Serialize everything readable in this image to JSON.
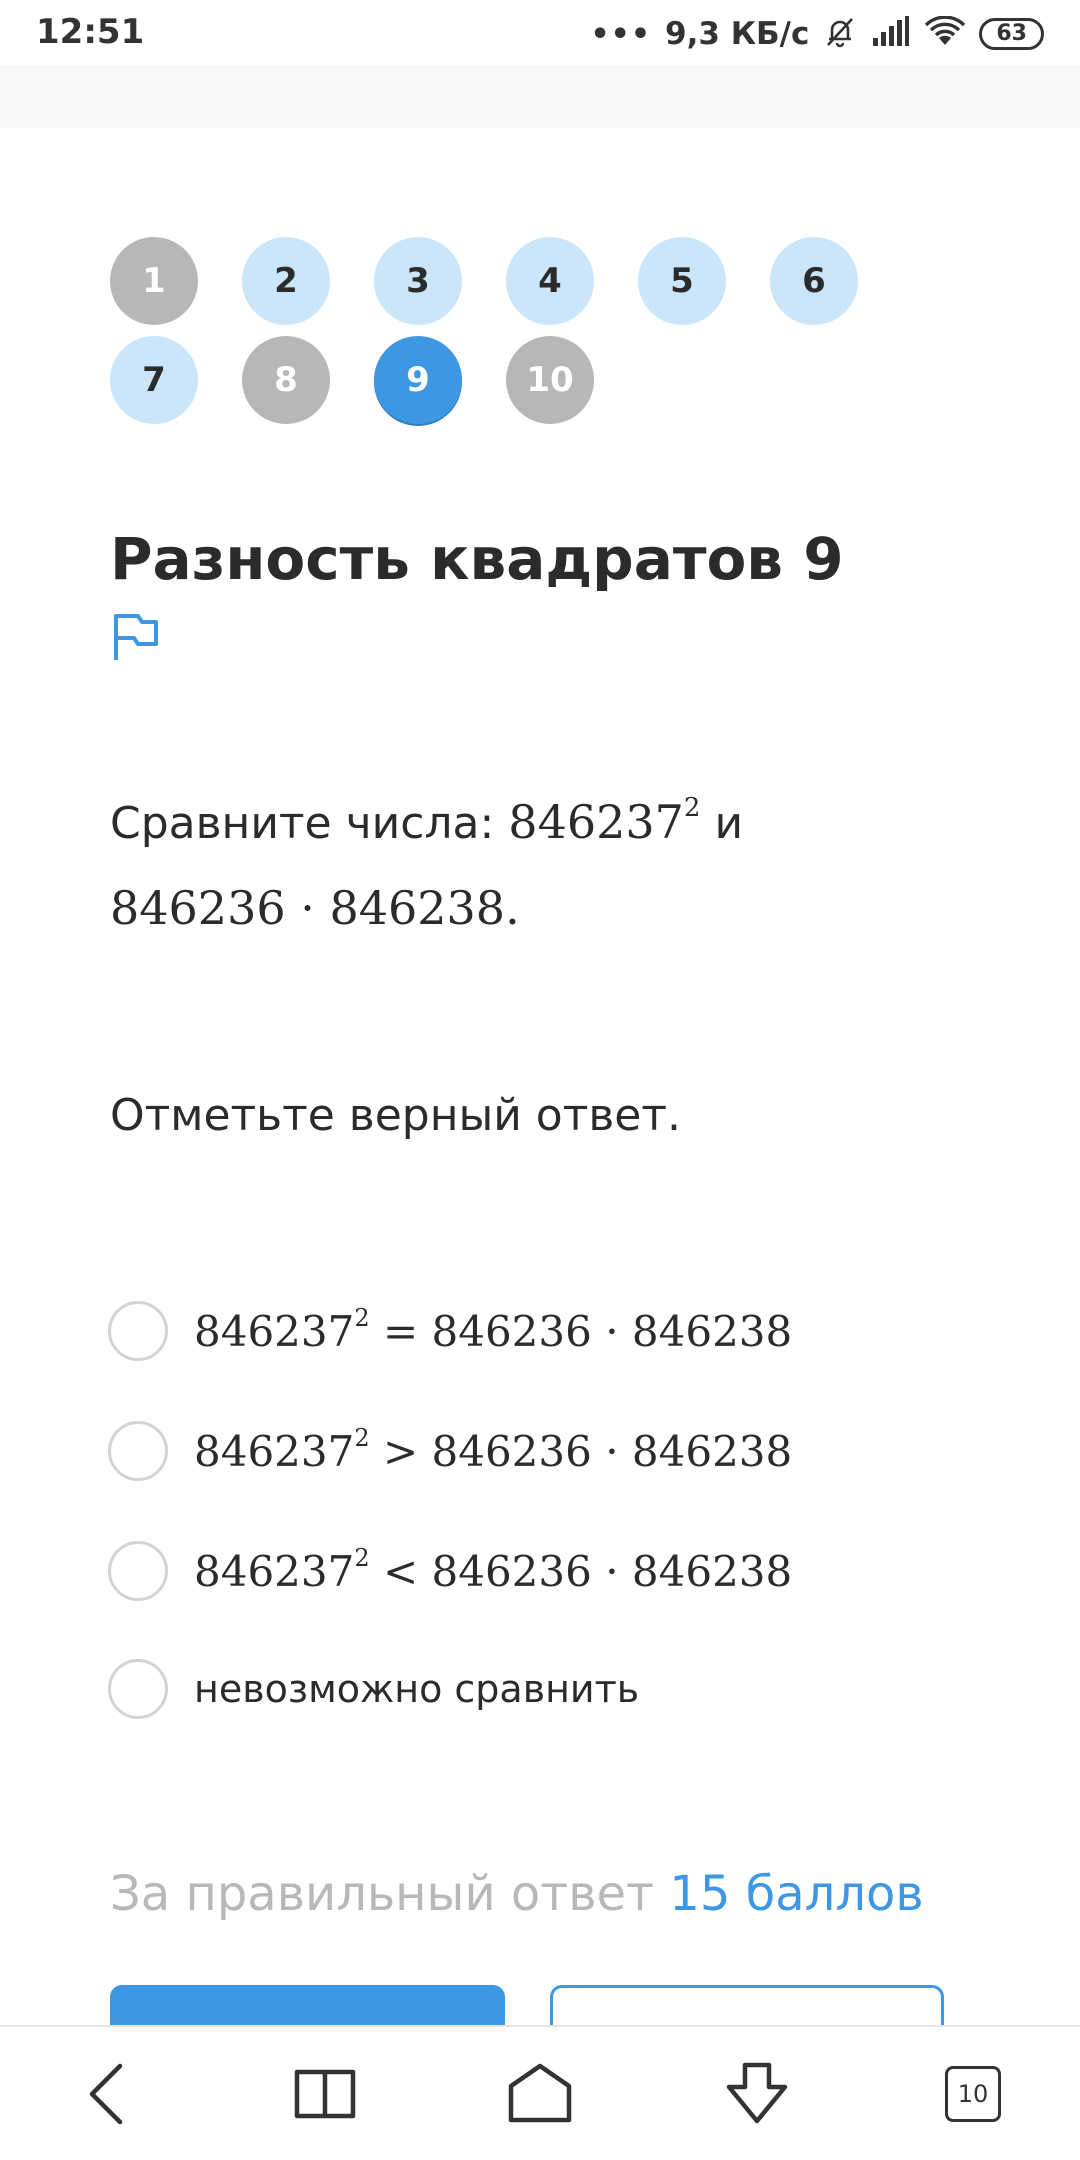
{
  "status_bar": {
    "time": "12:51",
    "dots": "•••",
    "speed": "9,3 КБ/с",
    "battery": "63"
  },
  "pagination": {
    "items": [
      {
        "label": "1",
        "state": "done"
      },
      {
        "label": "2",
        "state": "todo"
      },
      {
        "label": "3",
        "state": "todo"
      },
      {
        "label": "4",
        "state": "todo"
      },
      {
        "label": "5",
        "state": "todo"
      },
      {
        "label": "6",
        "state": "todo"
      },
      {
        "label": "7",
        "state": "todo"
      },
      {
        "label": "8",
        "state": "done"
      },
      {
        "label": "9",
        "state": "current"
      },
      {
        "label": "10",
        "state": "done"
      }
    ]
  },
  "task": {
    "title": "Разность квадратов 9",
    "question_prefix": "Сравните числа:",
    "q_base": "846237",
    "q_exp": "2",
    "q_and": "и",
    "q_product": "846236 · 846238.",
    "instruction": "Отметьте верный ответ."
  },
  "options": [
    {
      "base": "846237",
      "exp": "2",
      "rest": " = 846236 · 846238"
    },
    {
      "base": "846237",
      "exp": "2",
      "rest": " > 846236 · 846238"
    },
    {
      "base": "846237",
      "exp": "2",
      "rest": " < 846236 · 846238"
    },
    {
      "text": "невозможно сравнить"
    }
  ],
  "points": {
    "prefix": "За правильный ответ",
    "value": "15 баллов"
  },
  "bottom_nav": {
    "tabs_count": "10"
  },
  "colors": {
    "accent": "#3d97e3",
    "pill_done": "#b7b7b7",
    "pill_todo": "#cbe6fb"
  }
}
